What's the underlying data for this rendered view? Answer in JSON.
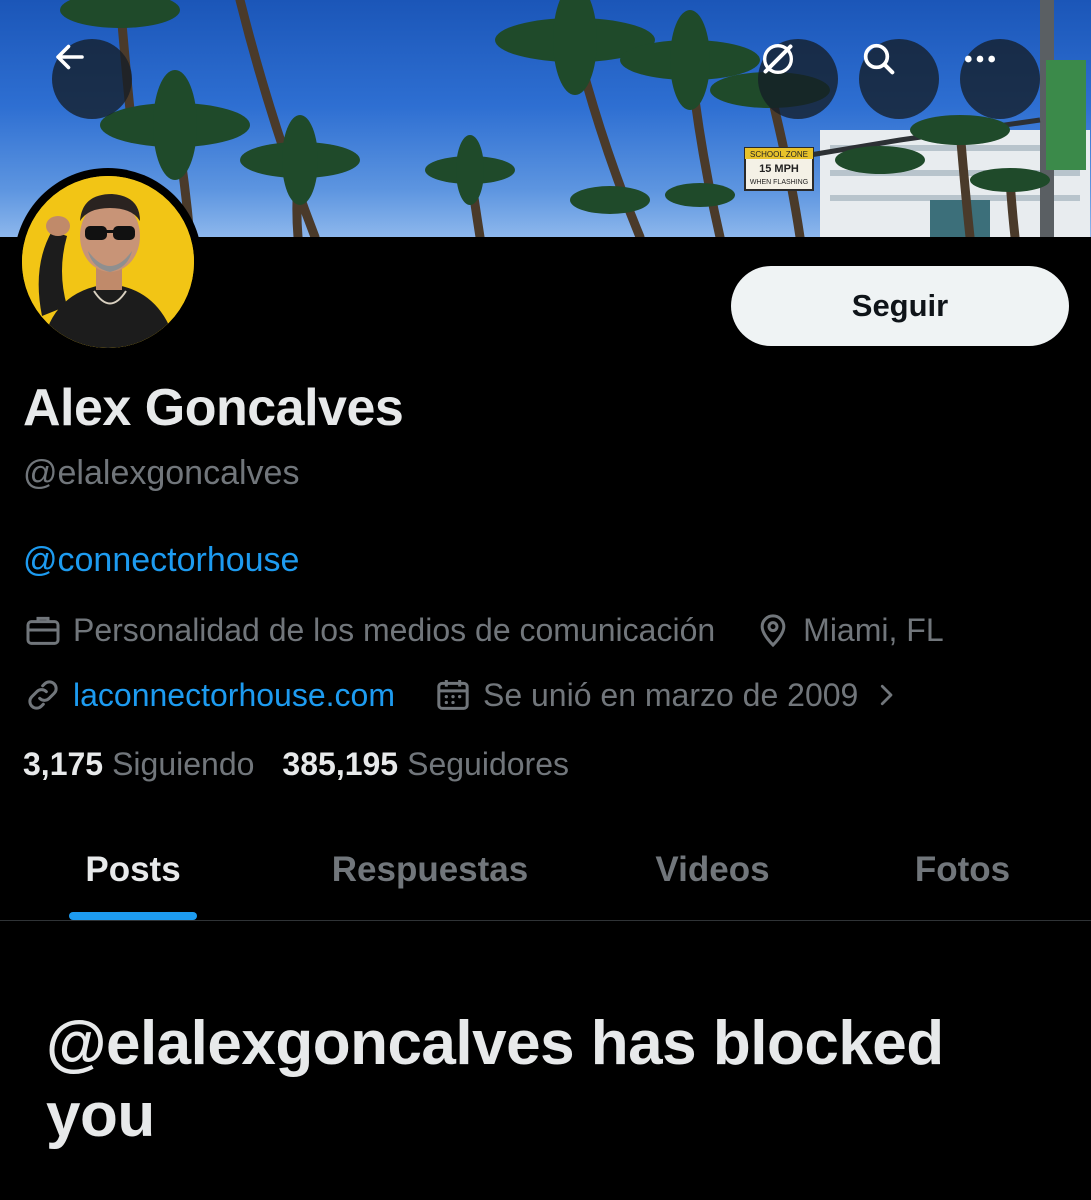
{
  "header": {
    "back_icon": "arrow-left-icon",
    "grok_icon": "slash-circle-icon",
    "search_icon": "search-icon",
    "more_icon": "more-horizontal-icon",
    "banner_sign_lines": [
      "SCHOOL ZONE",
      "15 MPH",
      "WHEN FLASHING"
    ]
  },
  "profile": {
    "follow_label": "Seguir",
    "name": "Alex Goncalves",
    "handle": "@elalexgoncalves",
    "bio_mention": "@connectorhouse",
    "category": "Personalidad de los medios de comunicación",
    "location": "Miami, FL",
    "website": "laconnectorhouse.com",
    "joined": "Se unió en marzo de 2009"
  },
  "stats": {
    "following_count": "3,175",
    "following_label": "Siguiendo",
    "followers_count": "385,195",
    "followers_label": "Seguidores"
  },
  "tabs": [
    {
      "label": "Posts",
      "active": true
    },
    {
      "label": "Respuestas",
      "active": false
    },
    {
      "label": "Videos",
      "active": false
    },
    {
      "label": "Fotos",
      "active": false
    }
  ],
  "blocked_message": "@elalexgoncalves has blocked you",
  "colors": {
    "background": "#000000",
    "accent": "#1d9bf0",
    "muted": "#71767b",
    "text": "#e7e9ea",
    "follow_button_bg": "#eff3f4",
    "avatar_bg": "#f2c515"
  }
}
